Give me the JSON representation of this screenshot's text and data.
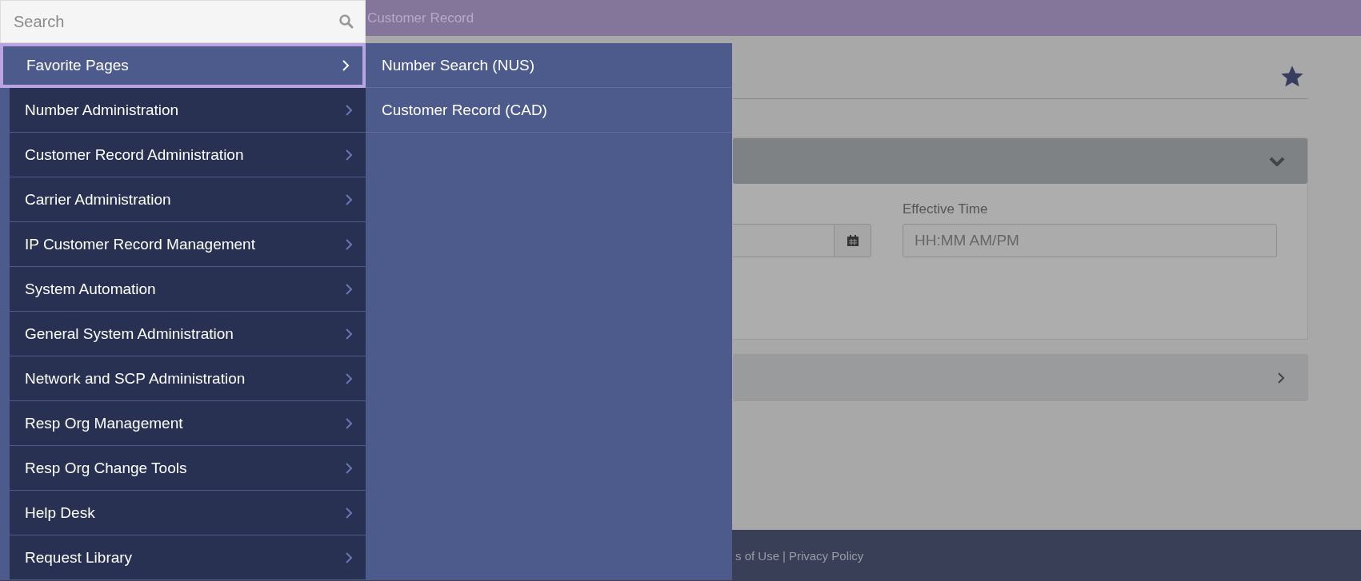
{
  "search": {
    "placeholder": "Search"
  },
  "breadcrumb": "Customer Record",
  "menu": [
    {
      "label": "Favorite Pages",
      "selected": true
    },
    {
      "label": "Number Administration",
      "selected": false
    },
    {
      "label": "Customer Record Administration",
      "selected": false
    },
    {
      "label": "Carrier Administration",
      "selected": false
    },
    {
      "label": "IP Customer Record Management",
      "selected": false
    },
    {
      "label": "System Automation",
      "selected": false
    },
    {
      "label": "General System Administration",
      "selected": false
    },
    {
      "label": "Network and SCP Administration",
      "selected": false
    },
    {
      "label": "Resp Org Management",
      "selected": false
    },
    {
      "label": "Resp Org Change Tools",
      "selected": false
    },
    {
      "label": "Help Desk",
      "selected": false
    },
    {
      "label": "Request Library",
      "selected": false
    }
  ],
  "submenu": [
    {
      "label": "Number Search (NUS)"
    },
    {
      "label": "Customer Record (CAD)"
    }
  ],
  "panels": [
    {
      "expanded": true,
      "fields": [
        {
          "kind": "date"
        },
        {
          "kind": "time",
          "label": "Effective Time",
          "placeholder": "HH:MM AM/PM"
        }
      ]
    },
    {
      "expanded": false
    }
  ],
  "footer": {
    "links": [
      "s of Use",
      "Privacy Policy"
    ],
    "separator": "|"
  }
}
